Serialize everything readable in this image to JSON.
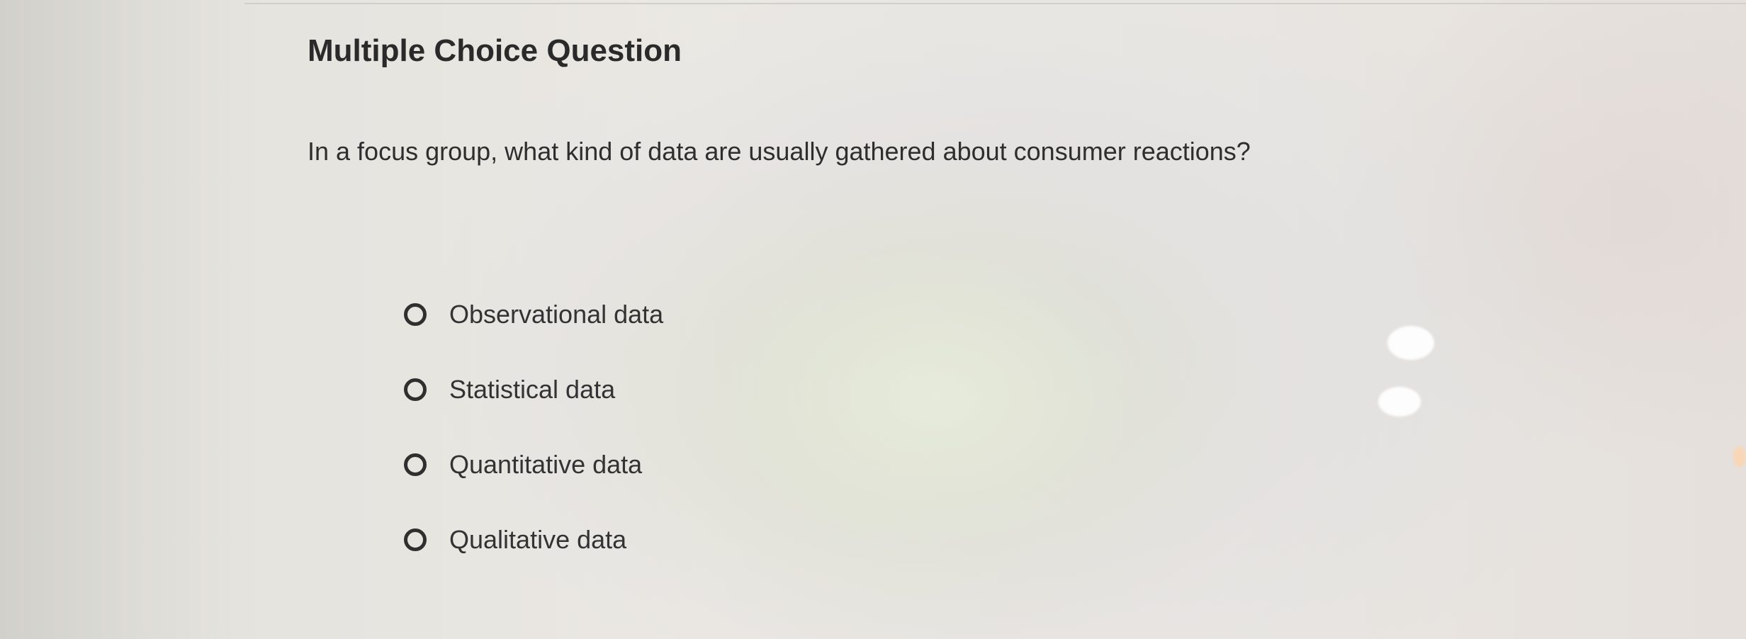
{
  "question": {
    "heading": "Multiple Choice Question",
    "prompt": "In a focus group, what kind of data are usually gathered about consumer reactions?",
    "options": [
      {
        "label": "Observational data",
        "selected": false
      },
      {
        "label": "Statistical data",
        "selected": false
      },
      {
        "label": "Quantitative data",
        "selected": false
      },
      {
        "label": "Qualitative data",
        "selected": false
      }
    ]
  }
}
